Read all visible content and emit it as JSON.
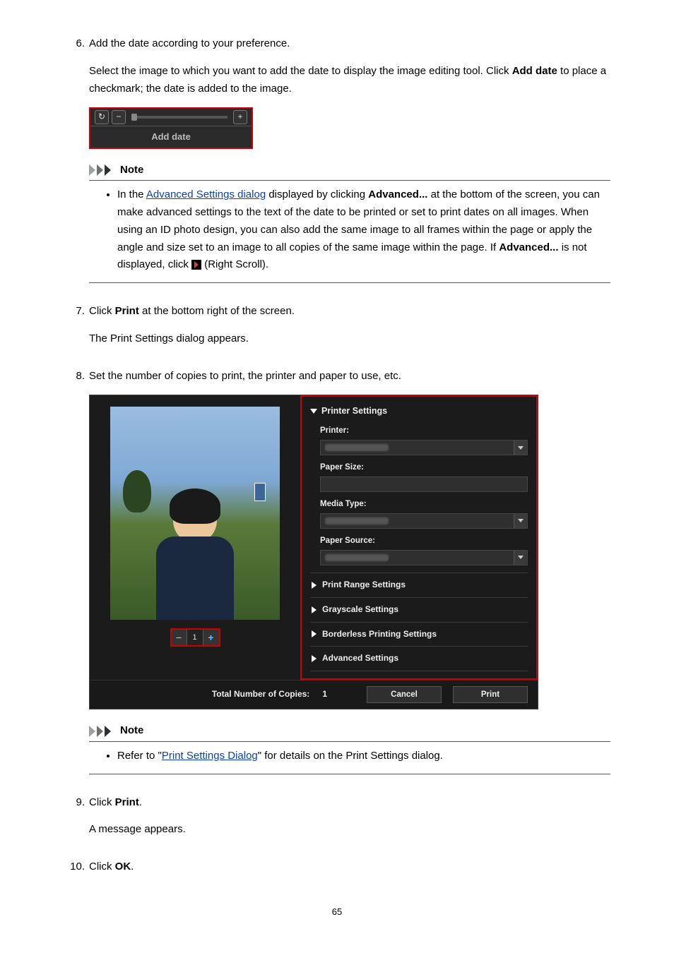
{
  "steps": {
    "s6": {
      "num": "6.",
      "title_pre": "Add the date according to your preference.",
      "body_pre": "Select the image to which you want to add the date to display the image editing tool. Click ",
      "body_bold": "Add date",
      "body_post": " to place a checkmark; the date is added to the image.",
      "widget_label": "Add date",
      "note_label": "Note",
      "note_pre": "In the ",
      "note_link": "Advanced Settings dialog",
      "note_mid1": " displayed by clicking ",
      "note_bold1": "Advanced...",
      "note_mid2": " at the bottom of the screen, you can make advanced settings to the text of the date to be printed or set to print dates on all images. When using an ID photo design, you can also add the same image to all frames within the page or apply the angle and size set to an image to all copies of the same image within the page. If ",
      "note_bold2": "Advanced...",
      "note_mid3": " is not displayed, click ",
      "note_post": " (Right Scroll)."
    },
    "s7": {
      "num": "7.",
      "title_pre": "Click ",
      "title_bold": "Print",
      "title_post": " at the bottom right of the screen.",
      "body": "The Print Settings dialog appears."
    },
    "s8": {
      "num": "8.",
      "title": "Set the number of copies to print, the printer and paper to use, etc.",
      "dialog": {
        "section": "Printer Settings",
        "printer_lbl": "Printer:",
        "paper_lbl": "Paper Size:",
        "media_lbl": "Media Type:",
        "source_lbl": "Paper Source:",
        "sub1": "Print Range Settings",
        "sub2": "Grayscale Settings",
        "sub3": "Borderless Printing Settings",
        "sub4": "Advanced Settings",
        "copies_val": "1",
        "total_lbl": "Total Number of Copies:",
        "total_val": "1",
        "cancel": "Cancel",
        "print": "Print"
      },
      "note_label": "Note",
      "note_pre": "Refer to \"",
      "note_link": "Print Settings Dialog",
      "note_post": "\" for details on the Print Settings dialog."
    },
    "s9": {
      "num": "9.",
      "title_pre": "Click ",
      "title_bold": "Print",
      "title_post": ".",
      "body": "A message appears."
    },
    "s10": {
      "num": "10.",
      "title_pre": "Click ",
      "title_bold": "OK",
      "title_post": "."
    }
  },
  "page_num": "65"
}
